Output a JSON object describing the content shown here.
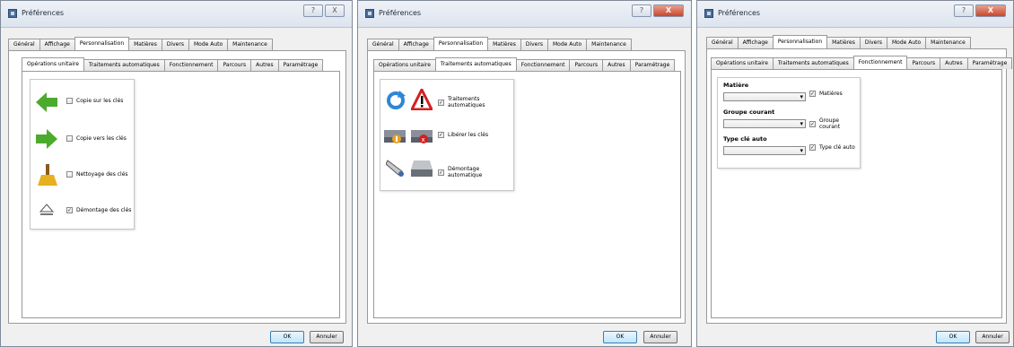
{
  "window_title": "Préférences",
  "main_tabs": [
    "Général",
    "Affichage",
    "Personnalisation",
    "Matières",
    "Divers",
    "Mode Auto",
    "Maintenance"
  ],
  "sub_tabs": [
    "Opérations unitaire",
    "Traitements automatiques",
    "Fonctionnement",
    "Parcours",
    "Autres",
    "Paramétrage"
  ],
  "buttons": {
    "ok": "OK",
    "cancel": "Annuler"
  },
  "titlebar_buttons": {
    "help": "?",
    "close": "X",
    "min": "−"
  },
  "panel1": {
    "items": [
      {
        "label": "Copie sur les clés",
        "checked": false
      },
      {
        "label": "Copie vers les clés",
        "checked": false
      },
      {
        "label": "Nettoyage des clés",
        "checked": false
      },
      {
        "label": "Démontage des clés",
        "checked": true
      }
    ]
  },
  "panel2": {
    "items": [
      {
        "label": "Traitements automatiques",
        "checked": true
      },
      {
        "label": "Libérer les clés",
        "checked": true
      },
      {
        "label": "Démontage automatique",
        "checked": true
      }
    ]
  },
  "panel3": {
    "groups": [
      {
        "title": "Matière",
        "check_label": "Matières",
        "checked": true,
        "value": ""
      },
      {
        "title": "Groupe courant",
        "check_label": "Groupe courant",
        "checked": true,
        "value": ""
      },
      {
        "title": "Type clé auto",
        "check_label": "Type clé auto",
        "checked": true,
        "value": ""
      }
    ]
  },
  "colors": {
    "arrow_green": "#4caa2c",
    "warning_red": "#d42020",
    "refresh_blue": "#2f86d6"
  }
}
